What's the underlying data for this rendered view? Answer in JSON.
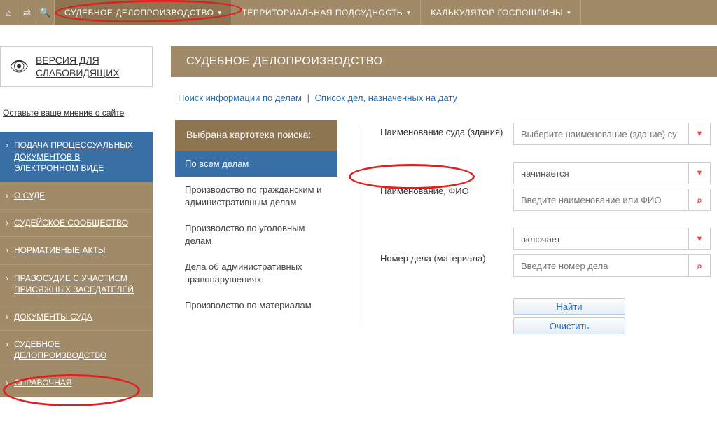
{
  "topbar": {
    "items": [
      {
        "label": "СУДЕБНОЕ ДЕЛОПРОИЗВОДСТВО"
      },
      {
        "label": "ТЕРРИТОРИАЛЬНАЯ ПОДСУДНОСТЬ"
      },
      {
        "label": "КАЛЬКУЛЯТОР ГОСПОШЛИНЫ"
      }
    ]
  },
  "accessibility": {
    "label": "ВЕРСИЯ ДЛЯ СЛАБОВИДЯЩИХ"
  },
  "feedback": "Оставьте ваше мнение о сайте",
  "sidebar": {
    "items": [
      {
        "label": "ПОДАЧА ПРОЦЕССУАЛЬНЫХ ДОКУМЕНТОВ В ЭЛЕКТРОННОМ ВИДЕ"
      },
      {
        "label": "О СУДЕ"
      },
      {
        "label": "СУДЕЙСКОЕ СООБЩЕСТВО"
      },
      {
        "label": "НОРМАТИВНЫЕ АКТЫ"
      },
      {
        "label": "ПРАВОСУДИЕ С УЧАСТИЕМ ПРИСЯЖНЫХ ЗАСЕДАТЕЛЕЙ"
      },
      {
        "label": "ДОКУМЕНТЫ СУДА"
      },
      {
        "label": "СУДЕБНОЕ ДЕЛОПРОИЗВОДСТВО"
      },
      {
        "label": "СПРАВОЧНАЯ"
      }
    ]
  },
  "page": {
    "title": "СУДЕБНОЕ ДЕЛОПРОИЗВОДСТВО"
  },
  "sublinks": {
    "search": "Поиск информации по делам",
    "list": "Список дел, назначенных на дату"
  },
  "card": {
    "header": "Выбрана картотека поиска:",
    "items": [
      "По всем делам",
      "Производство по гражданским и административным делам",
      "Производство по уголовным делам",
      "Дела об административных правонарушениях",
      "Производство по материалам"
    ]
  },
  "form": {
    "labels": {
      "court": "Наименование суда (здания)",
      "name": "Наименование, ФИО",
      "caseno": "Номер дела (материала)"
    },
    "court_placeholder": "Выберите наименование (здание) су",
    "name_mode": "начинается",
    "name_placeholder": "Введите наименование или ФИО",
    "case_mode": "включает",
    "case_placeholder": "Введите номер дела",
    "buttons": {
      "find": "Найти",
      "clear": "Очистить"
    }
  }
}
